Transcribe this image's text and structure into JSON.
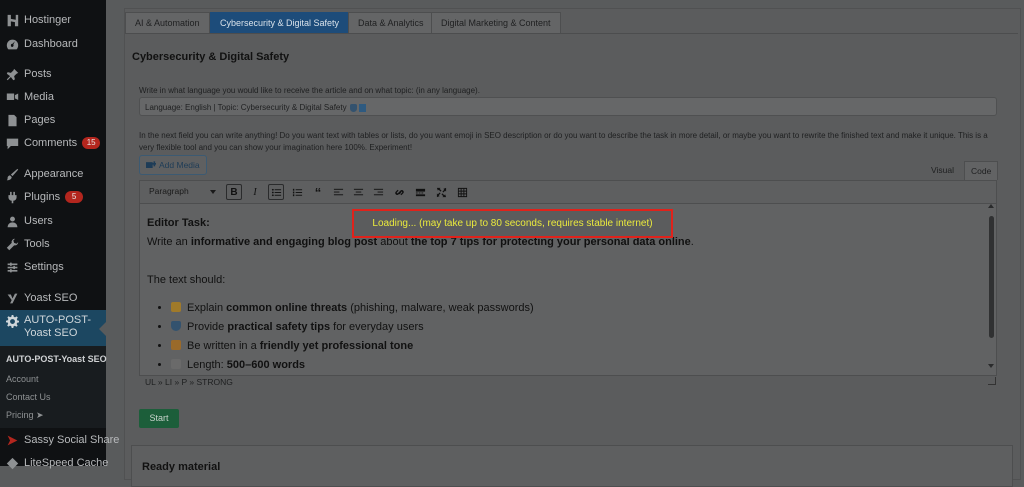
{
  "sidebar": {
    "items": [
      {
        "label": "Hostinger",
        "icon": "hostinger-icon"
      },
      {
        "label": "Dashboard",
        "icon": "dashboard-icon"
      },
      {
        "label": "Posts",
        "icon": "pin-icon"
      },
      {
        "label": "Media",
        "icon": "media-icon"
      },
      {
        "label": "Pages",
        "icon": "pages-icon"
      },
      {
        "label": "Comments",
        "icon": "comment-icon",
        "badge": "15"
      },
      {
        "label": "Appearance",
        "icon": "brush-icon"
      },
      {
        "label": "Plugins",
        "icon": "plug-icon",
        "badge": "5"
      },
      {
        "label": "Users",
        "icon": "user-icon"
      },
      {
        "label": "Tools",
        "icon": "wrench-icon"
      },
      {
        "label": "Settings",
        "icon": "settings-icon"
      },
      {
        "label": "Yoast SEO",
        "icon": "yoast-icon"
      },
      {
        "label": "AUTO-POST-Yoast SEO",
        "icon": "gear-icon",
        "active": true
      }
    ],
    "submenu": {
      "title": "AUTO-POST-Yoast SEO",
      "items": [
        "Account",
        "Contact Us",
        "Pricing ➤"
      ]
    },
    "after": [
      {
        "label": "Sassy Social Share",
        "icon": "share-icon"
      },
      {
        "label": "LiteSpeed Cache",
        "icon": "litespeed-icon"
      }
    ]
  },
  "tabs": [
    {
      "label": "AI & Automation",
      "active": false
    },
    {
      "label": "Cybersecurity & Digital Safety",
      "active": true
    },
    {
      "label": "Data & Analytics",
      "active": false
    },
    {
      "label": "Digital Marketing & Content",
      "active": false
    }
  ],
  "section_title": "Cybersecurity & Digital Safety",
  "language_prompt": "Write in what language you would like to receive the article and on what topic: (in any language).",
  "language_value": "Language: English | Topic: Cybersecurity & Digital Safety",
  "freeform_prompt": "In the next field you can write anything! Do you want text with tables or lists, do you want emoji in SEO description or do you want to describe the task in more detail, or maybe you want to rewrite the finished text and make it unique. This is a very flexible tool and you can show your imagination here 100%. Experiment!",
  "add_media_label": "Add Media",
  "editor_tabs": {
    "visual": "Visual",
    "code": "Code"
  },
  "format_select": "Paragraph",
  "editor": {
    "heading": "Editor Task:",
    "line1_pre": "Write an ",
    "line1_b1": "informative and engaging blog post",
    "line1_mid": " about ",
    "line1_b2": "the top 7 tips for protecting your personal data online",
    "line1_post": ".",
    "text_should": "The text should:",
    "items": [
      {
        "pre": "Explain ",
        "bold": "common online threats",
        "post": " (phishing, malware, weak passwords)",
        "emoji_color": "#a07a2a"
      },
      {
        "pre": "Provide ",
        "bold": "practical safety tips",
        "post": " for everyday users",
        "emoji_color": "#33526e"
      },
      {
        "pre": "Be written in a ",
        "bold": "friendly yet professional tone",
        "post": "",
        "emoji_color": "#9a6a2a"
      },
      {
        "pre": "Length: ",
        "bold": "500–600 words",
        "post": "",
        "emoji_color": "#6a6a6a"
      }
    ]
  },
  "status_path": "UL » LI » P » STRONG",
  "start_label": "Start",
  "next_section_title": "Ready material",
  "loading_message": "Loading... (may take up to 80 seconds, requires stable internet)"
}
